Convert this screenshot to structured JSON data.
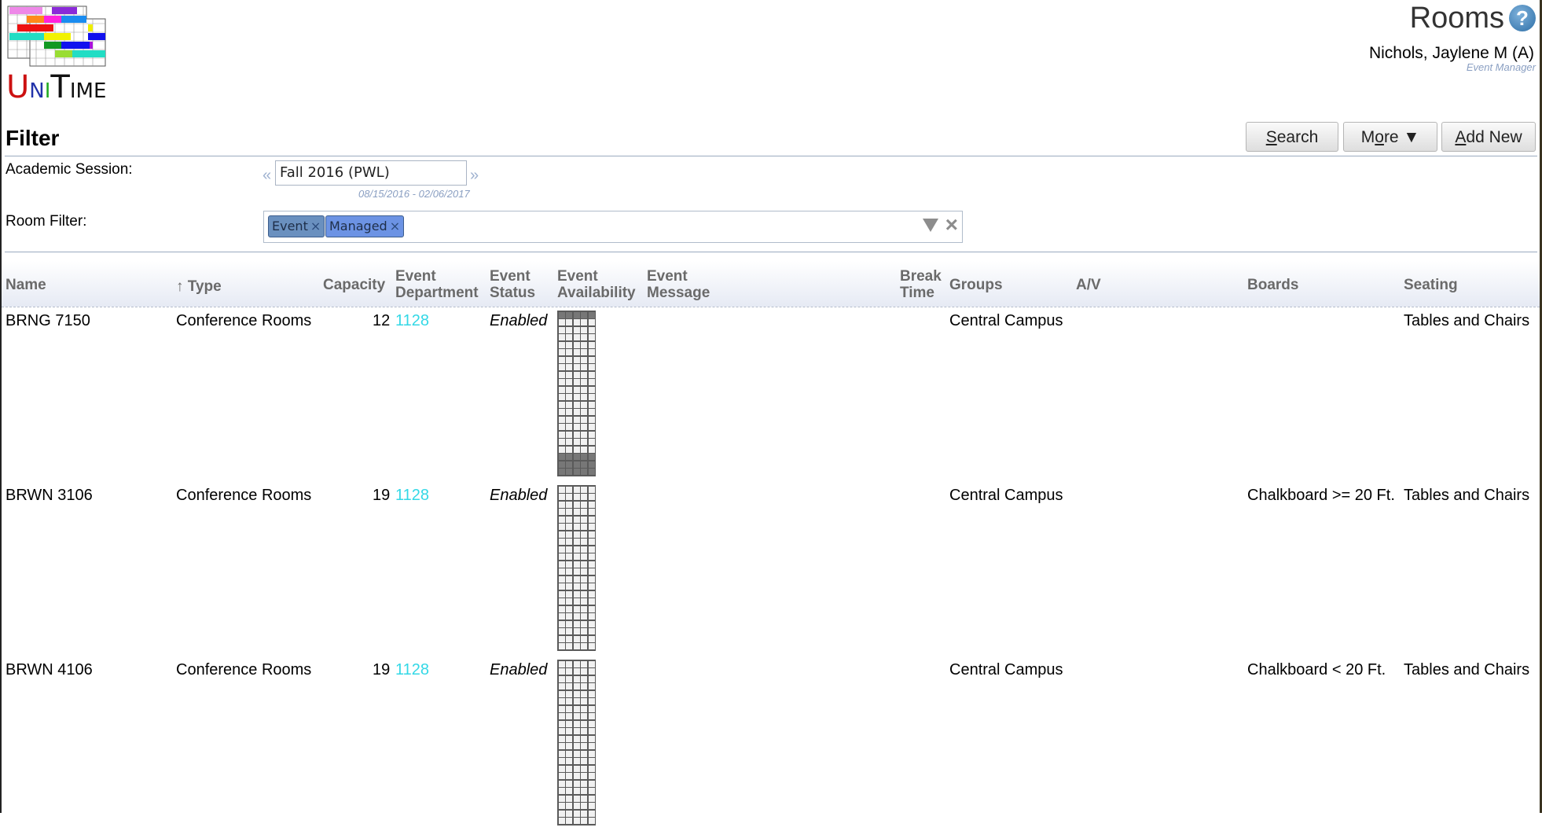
{
  "app": {
    "name": "UniTime",
    "logo_text": "UniTime"
  },
  "header": {
    "title": "Rooms",
    "help_icon": "help-icon",
    "user_name": "Nichols, Jaylene M (A)",
    "user_role": "Event Manager"
  },
  "filter": {
    "title": "Filter",
    "buttons": {
      "search": "earch",
      "search_accel": "S",
      "more_pre": "M",
      "more_accel": "o",
      "more_post": "re ▼",
      "add_accel": "A",
      "add": "dd New"
    },
    "academic_session_label": "Academic Session:",
    "academic_session_value": "Fall 2016 (PWL)",
    "academic_session_dates": "08/15/2016 - 02/06/2017",
    "prev_session": "«",
    "next_session": "»",
    "room_filter_label": "Room Filter:",
    "chips": [
      {
        "label": "Event",
        "remove": "×",
        "color": "#6a90bf"
      },
      {
        "label": "Managed",
        "remove": "×",
        "color": "#6c93e4"
      }
    ],
    "dropdown_icon": "triangle-down-icon",
    "clear_icon": "×"
  },
  "table": {
    "columns": [
      {
        "l1": "",
        "l2": "Name"
      },
      {
        "l1": "",
        "l2": "↑ Type"
      },
      {
        "l1": "",
        "l2": "Capacity"
      },
      {
        "l1": "Event",
        "l2": "Department"
      },
      {
        "l1": "Event",
        "l2": "Status"
      },
      {
        "l1": "Event",
        "l2": "Availability"
      },
      {
        "l1": "Event",
        "l2": "Message"
      },
      {
        "l1": "Break",
        "l2": "Time"
      },
      {
        "l1": "",
        "l2": "Groups"
      },
      {
        "l1": "",
        "l2": "A/V"
      },
      {
        "l1": "",
        "l2": "Boards"
      },
      {
        "l1": "",
        "l2": "Seating"
      }
    ],
    "rows": [
      {
        "name": "BRNG 7150",
        "type": "Conference Rooms",
        "capacity": "12",
        "department": "1128",
        "status": "Enabled",
        "message": "",
        "break_time": "",
        "groups": "Central Campus",
        "av": "",
        "boards": "",
        "seating": "Tables and Chairs",
        "availability": {
          "columns": 5,
          "rows": 22,
          "unavailable_rows": [
            0,
            19,
            20,
            21
          ]
        }
      },
      {
        "name": "BRWN 3106",
        "type": "Conference Rooms",
        "capacity": "19",
        "department": "1128",
        "status": "Enabled",
        "message": "",
        "break_time": "",
        "groups": "Central Campus",
        "av": "",
        "boards": "Chalkboard >= 20 Ft.",
        "seating": "Tables and Chairs",
        "availability": {
          "columns": 5,
          "rows": 22,
          "unavailable_rows": []
        }
      },
      {
        "name": "BRWN 4106",
        "type": "Conference Rooms",
        "capacity": "19",
        "department": "1128",
        "status": "Enabled",
        "message": "",
        "break_time": "",
        "groups": "Central Campus",
        "av": "",
        "boards": "Chalkboard < 20 Ft.",
        "seating": "Tables and Chairs",
        "availability": {
          "columns": 5,
          "rows": 22,
          "unavailable_rows": []
        }
      }
    ]
  }
}
